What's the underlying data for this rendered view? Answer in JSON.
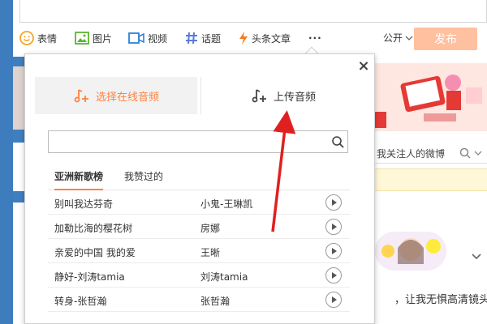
{
  "composer": {
    "toolbar": {
      "emoji": "表情",
      "image": "图片",
      "video": "视频",
      "topic": "话题",
      "article": "头条文章",
      "more": "···"
    },
    "visibility": "公开",
    "publish": "发布"
  },
  "popup": {
    "tab_online": "选择在线音频",
    "tab_upload": "上传音频",
    "search_placeholder": "",
    "list_tabs": [
      "亚洲新歌榜",
      "我赞过的"
    ],
    "songs": [
      {
        "title": "别叫我达芬奇",
        "artist": "小鬼-王琳凯"
      },
      {
        "title": "加勒比海的樱花树",
        "artist": "房娜"
      },
      {
        "title": "亲爱的中国 我的爱",
        "artist": "王晰"
      },
      {
        "title": "静好-刘涛tamia",
        "artist": "刘涛tamia"
      },
      {
        "title": "转身-张哲瀚",
        "artist": "张哲瀚"
      }
    ]
  },
  "background": {
    "follow_search_hint": "我关注人的微博",
    "feed_text": "，让我无惧高清镜头"
  },
  "colors": {
    "accent": "#ff8140",
    "publish_disabled": "#ffc09f",
    "arrow": "#e02020"
  }
}
